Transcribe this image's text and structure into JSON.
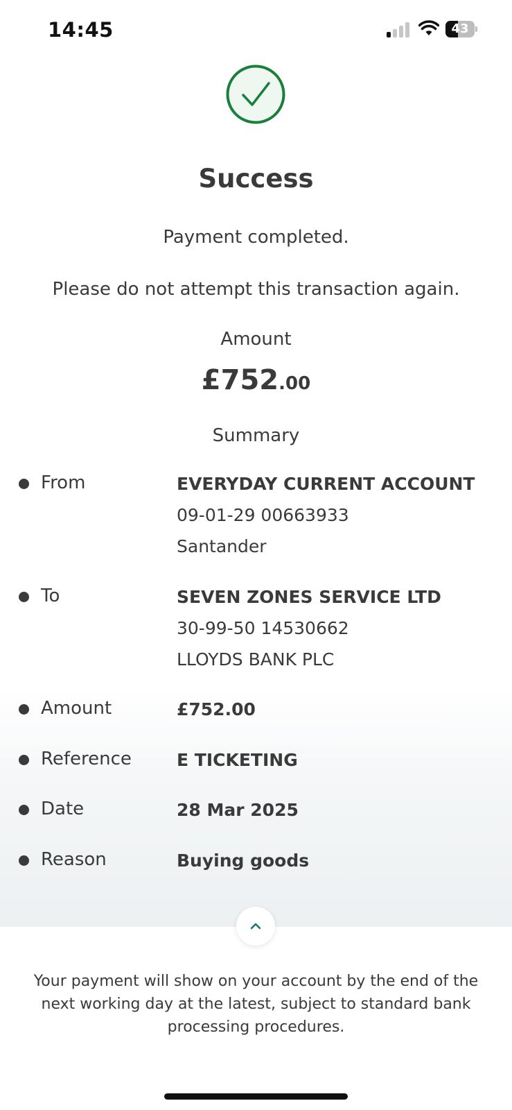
{
  "status_bar": {
    "time": "14:45",
    "battery_level": "43",
    "battery_fraction": 0.43
  },
  "header": {
    "icon": "check-circle-icon",
    "title": "Success",
    "message": "Payment completed.",
    "warning": "Please do not attempt this transaction again."
  },
  "amount": {
    "label": "Amount",
    "main": "£752",
    "decimals": ".00"
  },
  "summary": {
    "label": "Summary",
    "from": {
      "label": "From",
      "name": "EVERYDAY CURRENT ACCOUNT",
      "account": "09-01-29 00663933",
      "bank": "Santander"
    },
    "to": {
      "label": "To",
      "name": "SEVEN ZONES SERVICE LTD",
      "account": "30-99-50 14530662",
      "bank": "LLOYDS BANK PLC"
    },
    "amount": {
      "label": "Amount",
      "value": "£752.00"
    },
    "reference": {
      "label": "Reference",
      "value": "E TICKETING"
    },
    "date": {
      "label": "Date",
      "value": "28 Mar 2025"
    },
    "reason": {
      "label": "Reason",
      "value": "Buying goods"
    }
  },
  "collapse_button": {
    "icon": "chevron-up-icon"
  },
  "footer": {
    "note": "Your payment will show on your account by the end of the next working day at the latest, subject to standard bank processing procedures."
  },
  "colors": {
    "success_green": "#1a7f3c",
    "success_bg": "#eef7f0",
    "text": "#3a3a3a",
    "accent_teal": "#0e7a6e"
  }
}
